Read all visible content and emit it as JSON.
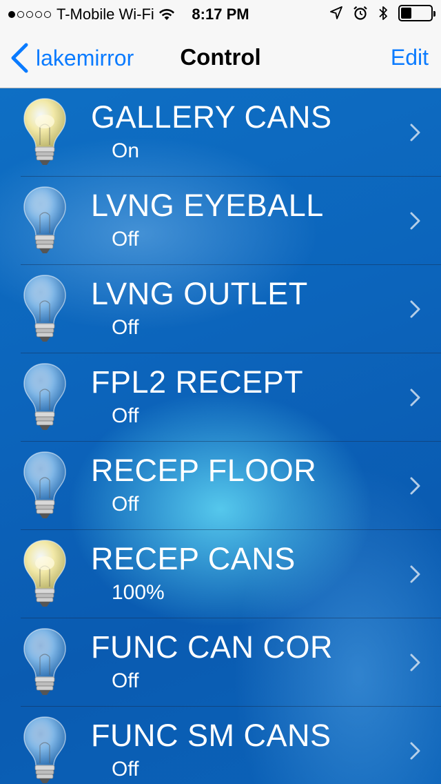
{
  "status_bar": {
    "carrier": "T-Mobile Wi-Fi",
    "time": "8:17 PM",
    "signal_bars_filled": 1,
    "signal_bars_total": 5,
    "battery_level": 0.35,
    "icons": [
      "wifi-icon",
      "location-icon",
      "alarm-icon",
      "bluetooth-icon",
      "battery-icon"
    ]
  },
  "nav": {
    "back_label": "lakemirror",
    "title": "Control",
    "edit_label": "Edit"
  },
  "colors": {
    "accent": "#0a7bff",
    "list_bg": "#0a63b8",
    "bulb_on": "#f2e9a8",
    "bulb_off": "#7fb6e6"
  },
  "devices": [
    {
      "name": "GALLERY CANS",
      "status": "On",
      "lit": true
    },
    {
      "name": "LVNG EYEBALL",
      "status": "Off",
      "lit": false
    },
    {
      "name": "LVNG OUTLET",
      "status": "Off",
      "lit": false
    },
    {
      "name": "FPL2 RECEPT",
      "status": "Off",
      "lit": false
    },
    {
      "name": "RECEP FLOOR",
      "status": "Off",
      "lit": false
    },
    {
      "name": "RECEP CANS",
      "status": "100%",
      "lit": true
    },
    {
      "name": "FUNC CAN COR",
      "status": "Off",
      "lit": false
    },
    {
      "name": "FUNC SM CANS",
      "status": "Off",
      "lit": false
    }
  ]
}
